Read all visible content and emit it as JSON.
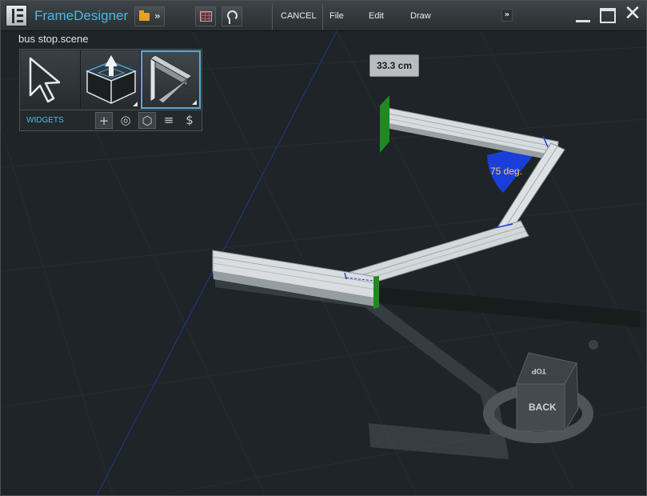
{
  "app": {
    "title": "FrameDesigner"
  },
  "toolbar": {
    "cancel_label": "CANCEL",
    "menu": [
      "File",
      "Edit",
      "Draw"
    ],
    "more_label": "»",
    "folder_more_label": "»"
  },
  "window_controls": {
    "close_glyph": "✕"
  },
  "scene": {
    "name": "bus stop.scene"
  },
  "tool_panel": {
    "widgets_label": "WIDGETS",
    "tools": [
      {
        "name": "select-tool",
        "icon": "arrow-cursor-icon"
      },
      {
        "name": "extrude-tool",
        "icon": "extrude-block-icon"
      },
      {
        "name": "frame-tool",
        "icon": "frame-profile-icon"
      }
    ],
    "widgets": [
      "+",
      "◎",
      "⬡",
      "≡",
      "$"
    ]
  },
  "viewport": {
    "measurement": "33.3 cm",
    "angle": "75 deg.",
    "view_cube": {
      "front_label": "BACK",
      "top_label": "TOP"
    }
  },
  "colors": {
    "accent": "#4fb6e3",
    "angle_fill": "#1a3fd9",
    "angle_text": "#f2d36b",
    "endpoint_marker": "#1f8a1f",
    "background": "#1e2427"
  }
}
